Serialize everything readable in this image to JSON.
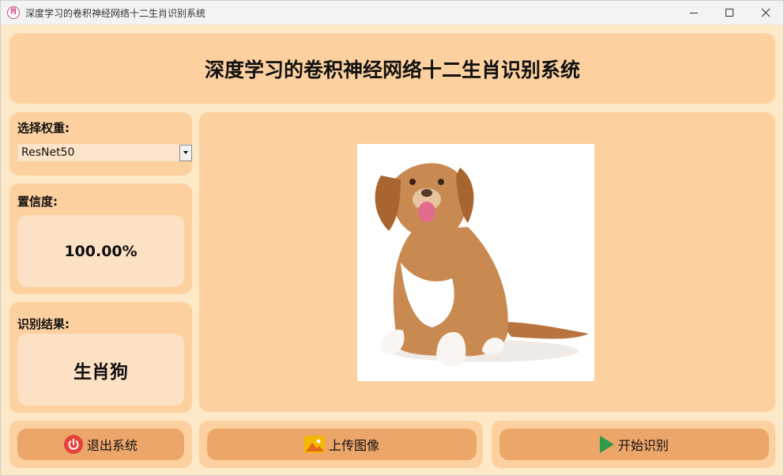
{
  "window": {
    "title": "深度学习的卷积神经网络十二生肖识别系统"
  },
  "header": {
    "title": "深度学习的卷积神经网络十二生肖识别系统"
  },
  "weights": {
    "label": "选择权重:",
    "selected": "ResNet50"
  },
  "confidence": {
    "label": "置信度:",
    "value": "100.00%"
  },
  "result": {
    "label": "识别结果:",
    "value": "生肖狗"
  },
  "image_panel": {
    "image_subject": "puppy-photo"
  },
  "buttons": {
    "exit_label": "退出系统",
    "upload_label": "上传图像",
    "start_label": "开始识别"
  },
  "colors": {
    "background": "#fde8c8",
    "panel": "#fdd19f",
    "value_box": "#fde1c5",
    "button": "#eda66a",
    "exit_icon": "#e64237",
    "upload_icon": "#f5b800",
    "start_icon": "#2e9c46"
  }
}
